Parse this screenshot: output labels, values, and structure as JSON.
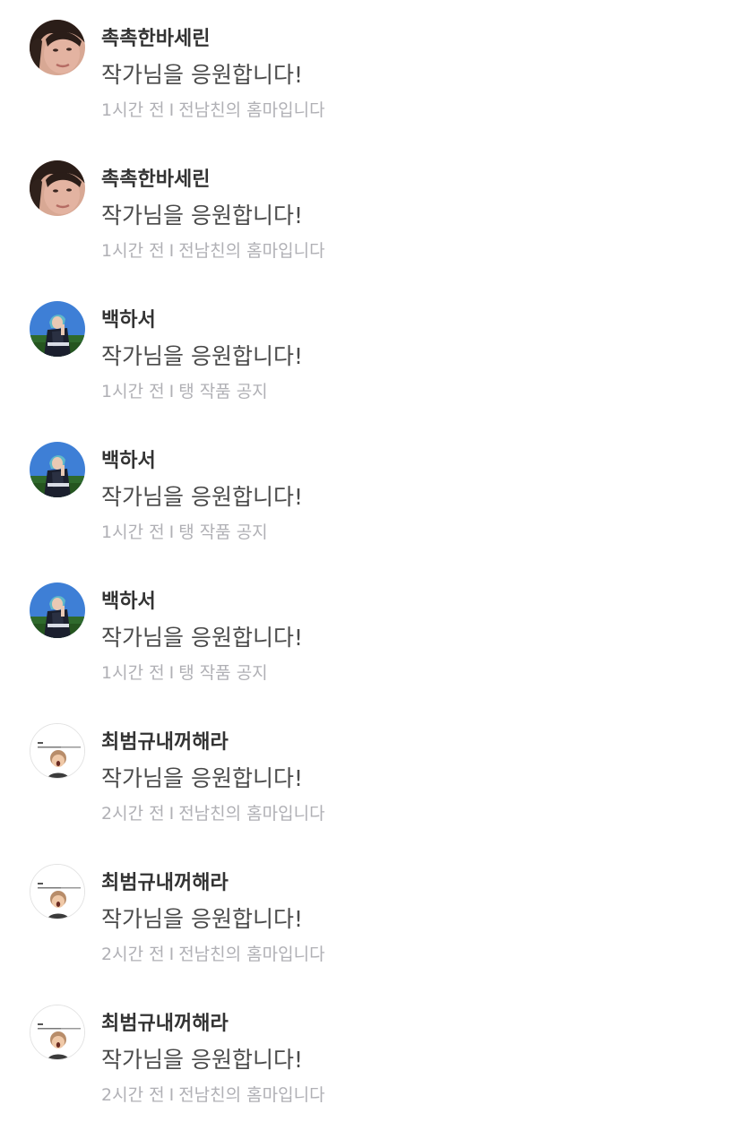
{
  "comments": [
    {
      "username": "촉촉한바세린",
      "message": "작가님을 응원합니다!",
      "time": "1시간 전",
      "separator": "I",
      "work": "전남친의 홈마입니다",
      "avatar": "avatar-dark-hair-photo"
    },
    {
      "username": "촉촉한바세린",
      "message": "작가님을 응원합니다!",
      "time": "1시간 전",
      "separator": "I",
      "work": "전남친의 홈마입니다",
      "avatar": "avatar-dark-hair-photo"
    },
    {
      "username": "백하서",
      "message": "작가님을 응원합니다!",
      "time": "1시간 전",
      "separator": "I",
      "work": "탱 작품 공지",
      "avatar": "avatar-stage-photo"
    },
    {
      "username": "백하서",
      "message": "작가님을 응원합니다!",
      "time": "1시간 전",
      "separator": "I",
      "work": "탱 작품 공지",
      "avatar": "avatar-stage-photo"
    },
    {
      "username": "백하서",
      "message": "작가님을 응원합니다!",
      "time": "1시간 전",
      "separator": "I",
      "work": "탱 작품 공지",
      "avatar": "avatar-stage-photo"
    },
    {
      "username": "최범규내꺼해라",
      "message": "작가님을 응원합니다!",
      "time": "2시간 전",
      "separator": "I",
      "work": "전남친의 홈마입니다",
      "avatar": "avatar-sticker-photo"
    },
    {
      "username": "최범규내꺼해라",
      "message": "작가님을 응원합니다!",
      "time": "2시간 전",
      "separator": "I",
      "work": "전남친의 홈마입니다",
      "avatar": "avatar-sticker-photo"
    },
    {
      "username": "최범규내꺼해라",
      "message": "작가님을 응원합니다!",
      "time": "2시간 전",
      "separator": "I",
      "work": "전남친의 홈마입니다",
      "avatar": "avatar-sticker-photo"
    }
  ],
  "colors": {
    "username": "#333333",
    "message": "#4a4a4a",
    "meta": "#b0b0b5",
    "background": "#ffffff"
  }
}
